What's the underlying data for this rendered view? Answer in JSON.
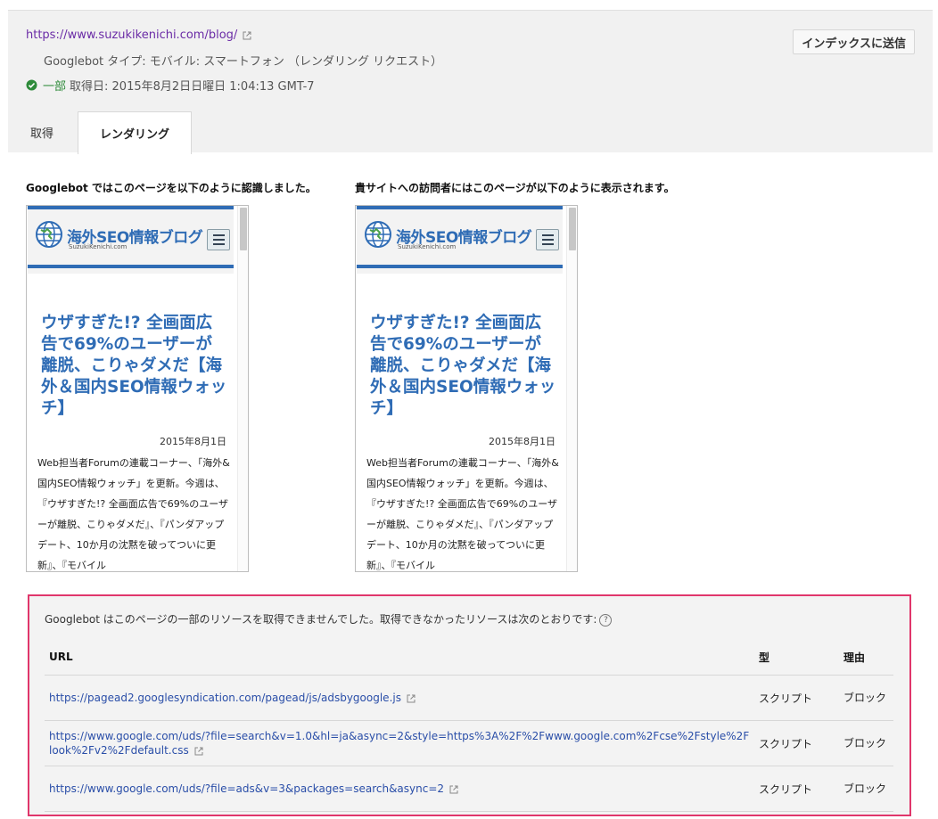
{
  "header": {
    "url": "https://www.suzukikenichi.com/blog/",
    "bot_type": "Googlebot タイプ: モバイル: スマートフォン （レンダリング リクエスト）",
    "status_word": "一部",
    "fetched_at": "取得日: 2015年8月2日日曜日 1:04:13 GMT-7",
    "submit_label": "インデックスに送信"
  },
  "tabs": [
    {
      "label": "取得"
    },
    {
      "label": "レンダリング"
    }
  ],
  "captions": {
    "googlebot": "Googlebot ではこのページを以下のように認識しました。",
    "visitor": "貴サイトへの訪問者にはこのページが以下のように表示されます。"
  },
  "preview": {
    "site_title": "海外SEO情報ブログ",
    "site_subtitle": "SuzukiKenichi.com",
    "article_title": "ウザすぎた!? 全画面広告で69%のユーザーが離脱、こりゃダメだ【海外＆国内SEO情報ウォッチ】",
    "article_date": "2015年8月1日",
    "article_body": "Web担当者Forumの連載コーナー、「海外&国内SEO情報ウォッチ」を更新。今週は、『ウザすぎた!? 全画面広告で69%のユーザーが離脱、こりゃダメだ』、『パンダアップデート、10か月の沈黙を破ってついに更新』、『モバイル"
  },
  "blocked": {
    "message": "Googlebot はこのページの一部のリソースを取得できませんでした。取得できなかったリソースは次のとおりです:",
    "help_glyph": "?",
    "columns": [
      "URL",
      "型",
      "理由"
    ],
    "rows": [
      {
        "url": "https://pagead2.googlesyndication.com/pagead/js/adsbygoogle.js",
        "type": "スクリプト",
        "reason": "ブロック"
      },
      {
        "url": "https://www.google.com/uds/?file=search&v=1.0&hl=ja&async=2&style=https%3A%2F%2Fwww.google.com%2Fcse%2Fstyle%2Flook%2Fv2%2Fdefault.css",
        "type": "スクリプト",
        "reason": "ブロック"
      },
      {
        "url": "https://www.google.com/uds/?file=ads&v=3&packages=search&async=2",
        "type": "スクリプト",
        "reason": "ブロック"
      }
    ]
  },
  "colors": {
    "link_visited": "#6a2ba6",
    "link": "#2a4ea8",
    "status_ok": "#2e8b3a",
    "highlight_border": "#e0366b",
    "site_blue": "#2f6cb5"
  }
}
